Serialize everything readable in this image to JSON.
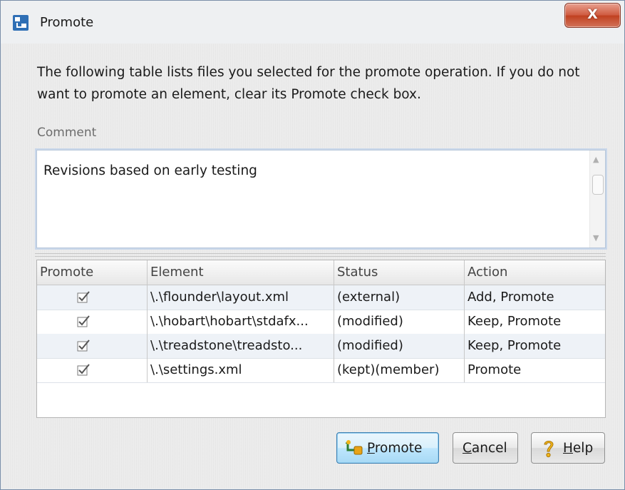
{
  "window": {
    "title": "Promote",
    "close_label": "X"
  },
  "instructions": "The following table lists files you selected for the promote operation. If you do not want to promote an element, clear its Promote check box.",
  "comment": {
    "label": "Comment",
    "value": "Revisions based on early testing"
  },
  "table": {
    "headers": {
      "promote": "Promote",
      "element": "Element",
      "status": "Status",
      "action": "Action"
    },
    "rows": [
      {
        "promote": true,
        "element": "\\.\\flounder\\layout.xml",
        "status": "(external)",
        "action": "Add, Promote"
      },
      {
        "promote": true,
        "element": "\\.\\hobart\\hobart\\stdafx...",
        "status": "(modified)",
        "action": "Keep, Promote"
      },
      {
        "promote": true,
        "element": "\\.\\treadstone\\treadsto...",
        "status": "(modified)",
        "action": "Keep, Promote"
      },
      {
        "promote": true,
        "element": "\\.\\settings.xml",
        "status": "(kept)(member)",
        "action": "Promote"
      }
    ]
  },
  "buttons": {
    "promote": {
      "mnemonic": "P",
      "rest": "romote"
    },
    "cancel": {
      "mnemonic": "C",
      "rest": "ancel"
    },
    "help": {
      "mnemonic": "H",
      "rest": "elp"
    }
  },
  "colors": {
    "default_button": "#bee6fd",
    "close_button": "#c0401f",
    "row_alt": "#eef2f7"
  }
}
